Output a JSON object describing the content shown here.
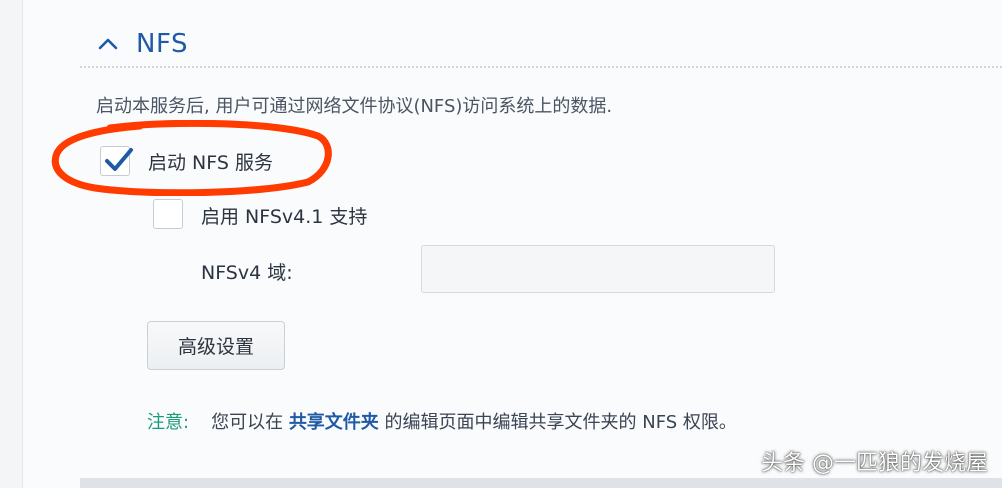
{
  "section": {
    "title": "NFS",
    "expanded": true,
    "chevron_icon": "chevron-up-icon"
  },
  "description": "启动本服务后, 用户可通过网络文件协议(NFS)访问系统上的数据.",
  "options": {
    "enable_nfs": {
      "label": "启动 NFS 服务",
      "checked": true
    },
    "enable_nfsv41": {
      "label": "启用 NFSv4.1 支持",
      "checked": false
    }
  },
  "nfsv4_domain": {
    "label": "NFSv4 域:",
    "value": ""
  },
  "advanced_button_label": "高级设置",
  "note": {
    "label": "注意:",
    "before_link": "您可以在",
    "link_text": "共享文件夹",
    "after_link": "的编辑页面中编辑共享文件夹的 NFS 权限。"
  },
  "annotation": {
    "color": "#ff3b00"
  },
  "colors": {
    "accent": "#1f5aa6",
    "note_label": "#1a9b7a",
    "checkmark": "#1f5aa6"
  },
  "watermark": "头条 @一匹狼的发烧屋"
}
